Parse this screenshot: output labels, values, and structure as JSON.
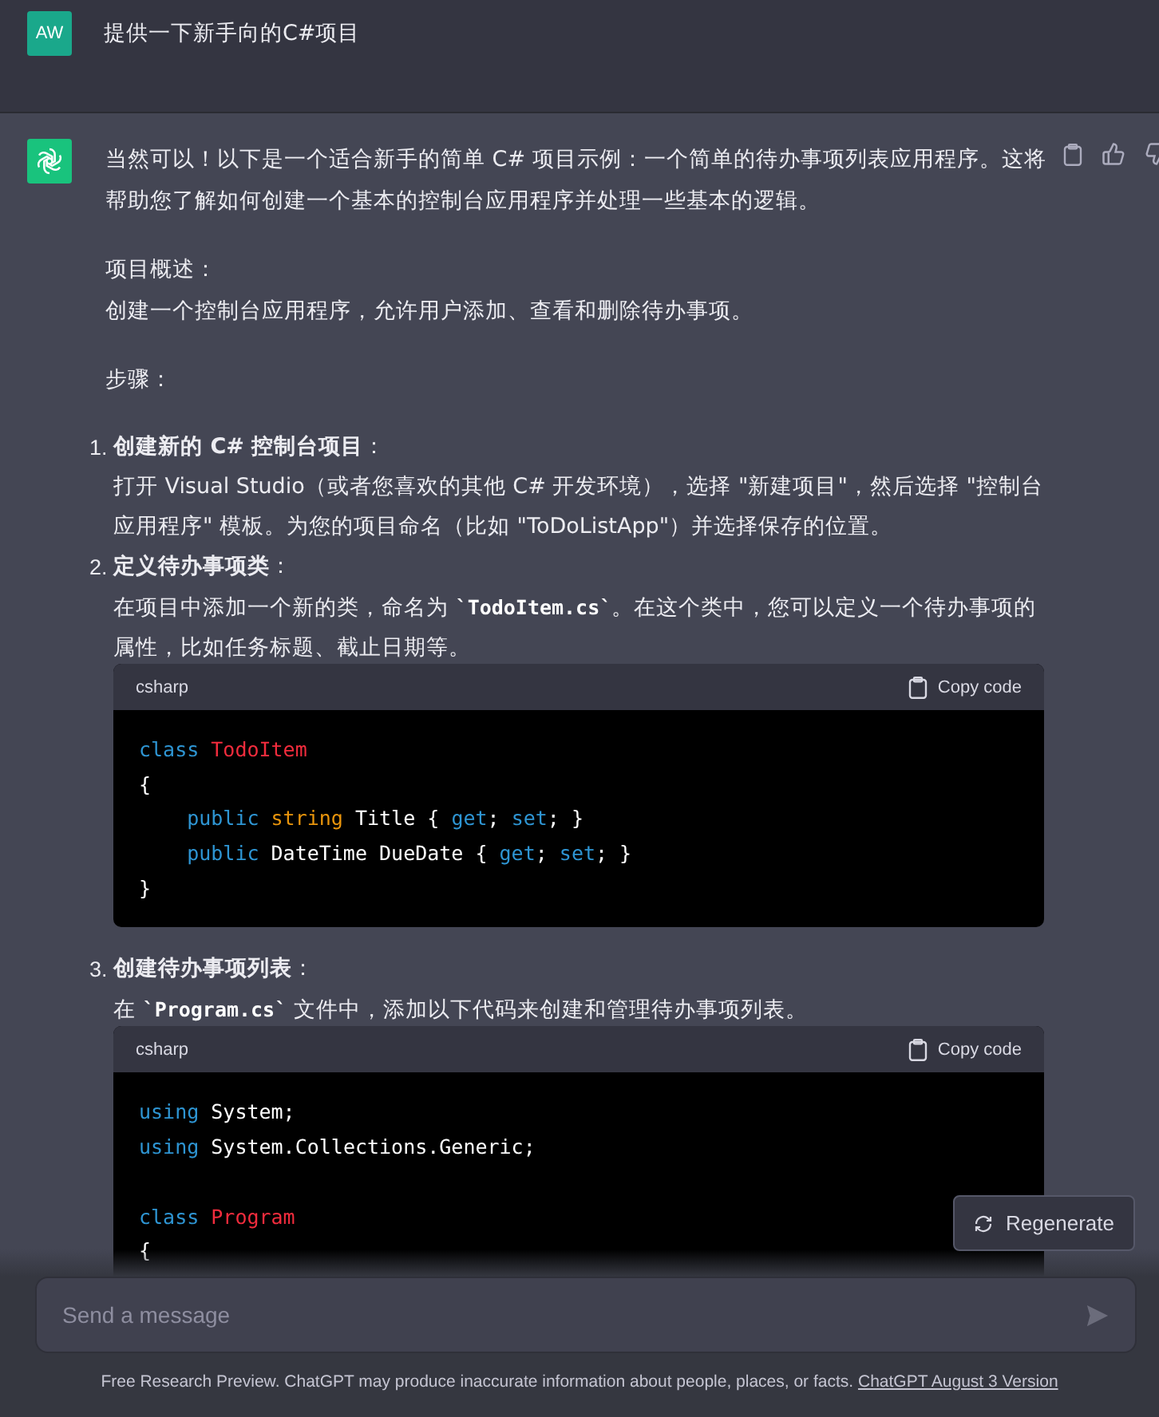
{
  "user_message": {
    "avatar": "AW",
    "text": "提供一下新手向的C#项目"
  },
  "assistant_message": {
    "intro": "当然可以！以下是一个适合新手的简单 C# 项目示例：一个简单的待办事项列表应用程序。这将帮助您了解如何创建一个基本的控制台应用程序并处理一些基本的逻辑。",
    "overview_label": "项目概述：",
    "overview_text": "创建一个控制台应用程序，允许用户添加、查看和删除待办事项。",
    "steps_label": "步骤：",
    "steps": [
      {
        "number": "1.",
        "title": "**创建新的 C# 控制台项目**：",
        "body": [
          {
            "text": "打开 Visual Studio（或者您喜欢的其他 C# 开发环境），选择 \"新建项目\"，然后选择 \"控制台应用程序\" 模板。为您的项目命名（比如 \"ToDoListApp\"）并选择保存的位置。"
          }
        ]
      },
      {
        "number": "2.",
        "title": "**定义待办事项类**：",
        "body": [
          {
            "text": "在项目中添加一个新的类，命名为 "
          },
          {
            "code": "`TodoItem.cs`"
          },
          {
            "text": "。在这个类中，您可以定义一个待办事项的属性，比如任务标题、截止日期等。"
          }
        ],
        "code_block": {
          "language": "csharp",
          "copy_label": "Copy code",
          "lines": [
            {
              "indented": false,
              "tokens": [
                {
                  "kind": "keyword",
                  "text": "class "
                },
                {
                  "kind": "classname",
                  "text": "TodoItem"
                }
              ]
            },
            {
              "indented": false,
              "tokens": [
                {
                  "kind": "plain",
                  "text": "{"
                }
              ]
            },
            {
              "indented": true,
              "tokens": [
                {
                  "kind": "keyword",
                  "text": "public "
                },
                {
                  "kind": "type",
                  "text": "string "
                },
                {
                  "kind": "plain",
                  "text": "Title { "
                },
                {
                  "kind": "keyword",
                  "text": "get"
                },
                {
                  "kind": "plain",
                  "text": "; "
                },
                {
                  "kind": "keyword",
                  "text": "set"
                },
                {
                  "kind": "plain",
                  "text": "; }"
                }
              ]
            },
            {
              "indented": true,
              "tokens": [
                {
                  "kind": "keyword",
                  "text": "public "
                },
                {
                  "kind": "plain",
                  "text": "DateTime DueDate { "
                },
                {
                  "kind": "keyword",
                  "text": "get"
                },
                {
                  "kind": "plain",
                  "text": "; "
                },
                {
                  "kind": "keyword",
                  "text": "set"
                },
                {
                  "kind": "plain",
                  "text": "; }"
                }
              ]
            },
            {
              "indented": false,
              "tokens": [
                {
                  "kind": "plain",
                  "text": "}"
                }
              ]
            }
          ]
        }
      },
      {
        "number": "3.",
        "title": "**创建待办事项列表**：",
        "body": [
          {
            "text": "在 "
          },
          {
            "code": "`Program.cs`"
          },
          {
            "text": " 文件中，添加以下代码来创建和管理待办事项列表。"
          }
        ],
        "code_block": {
          "language": "csharp",
          "copy_label": "Copy code",
          "lines": [
            {
              "indented": false,
              "tokens": [
                {
                  "kind": "keyword",
                  "text": "using "
                },
                {
                  "kind": "plain",
                  "text": "System;"
                }
              ]
            },
            {
              "indented": false,
              "tokens": [
                {
                  "kind": "keyword",
                  "text": "using "
                },
                {
                  "kind": "plain",
                  "text": "System.Collections.Generic;"
                }
              ]
            },
            {
              "blank": true
            },
            {
              "indented": false,
              "tokens": [
                {
                  "kind": "keyword",
                  "text": "class "
                },
                {
                  "kind": "classname",
                  "text": "Program"
                }
              ]
            },
            {
              "indented": false,
              "tokens": [
                {
                  "kind": "plain",
                  "text": "{"
                }
              ]
            }
          ]
        }
      }
    ]
  },
  "regenerate_label": "Regenerate",
  "composer": {
    "placeholder": "Send a message"
  },
  "footer": {
    "text": "Free Research Preview. ChatGPT may produce inaccurate information about people, places, or facts. ",
    "link": "ChatGPT August 3 Version"
  }
}
